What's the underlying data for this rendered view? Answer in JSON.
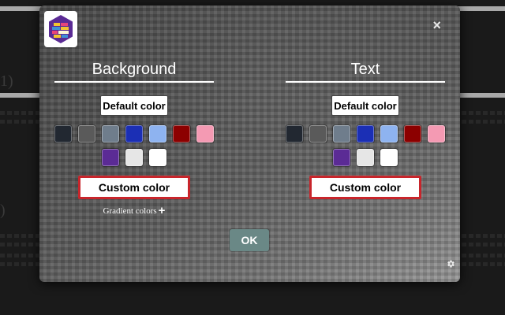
{
  "background_page": {
    "heading_1": "1)",
    "heading_2": ")"
  },
  "dialog": {
    "logo_icon": "brick-hexagon-logo",
    "close_icon": "close-icon",
    "close_label": "×",
    "ok_label": "OK",
    "settings_icon": "gear-icon",
    "background_panel": {
      "title": "Background",
      "default_label": "Default color",
      "swatches": [
        "#222831",
        "#5a5a5a",
        "#6f7d8c",
        "#1b2fb5",
        "#8eb3f0",
        "#8c0000",
        "#f49ab3",
        "#5b2b95",
        "#e6e6e6",
        "#ffffff"
      ],
      "custom_label": "Custom color",
      "gradient_label": "Gradient colors",
      "gradient_icon": "plus-icon",
      "gradient_symbol": "+"
    },
    "text_panel": {
      "title": "Text",
      "default_label": "Default color",
      "swatches": [
        "#222831",
        "#5a5a5a",
        "#6f7d8c",
        "#1b2fb5",
        "#8eb3f0",
        "#8c0000",
        "#f49ab3",
        "#5b2b95",
        "#e6e6e6",
        "#ffffff"
      ],
      "custom_label": "Custom color"
    }
  },
  "colors": {
    "custom_border": "#c8252b",
    "ok_button": "#6a8886"
  }
}
